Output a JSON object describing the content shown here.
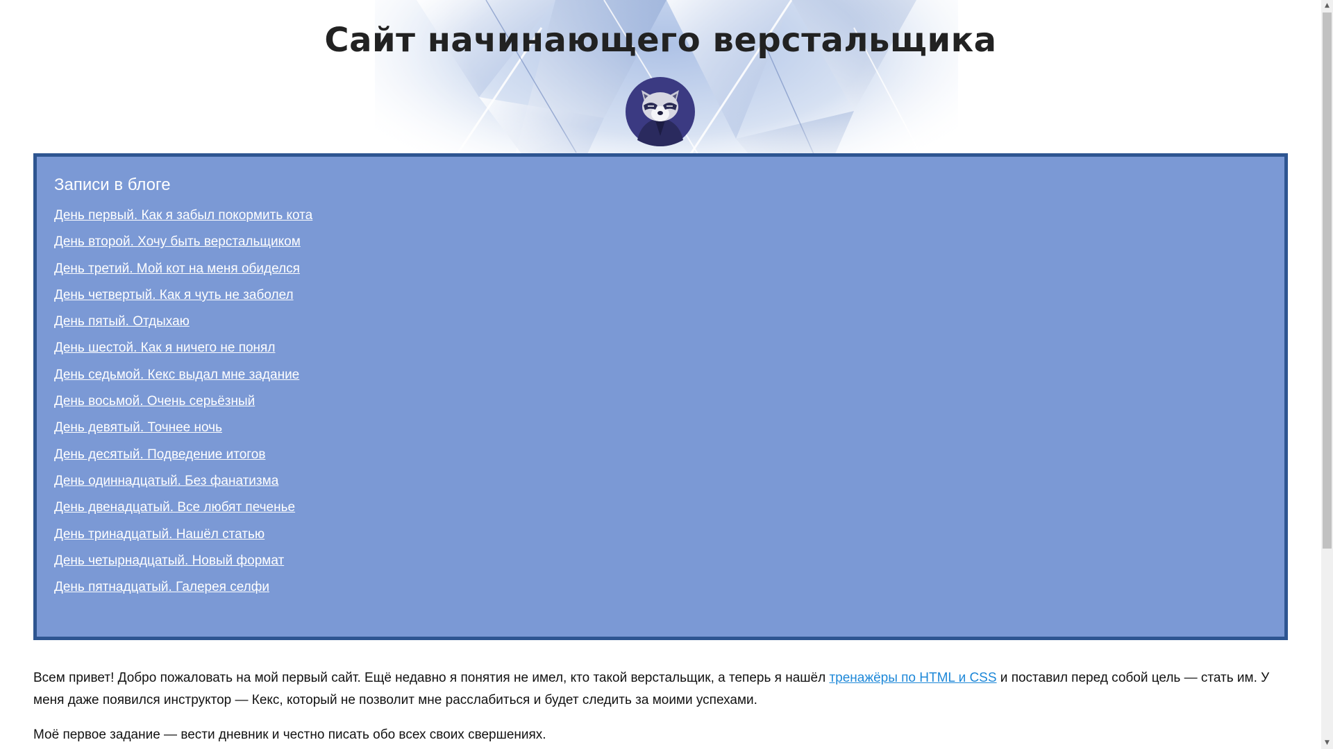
{
  "header": {
    "title": "Сайт начинающего верстальщика",
    "avatar_icon": "raccoon-avatar-icon"
  },
  "blog": {
    "heading": "Записи в блоге",
    "posts": [
      "День первый. Как я забыл покормить кота",
      "День второй. Хочу быть верстальщиком",
      "День третий. Мой кот на меня обиделся",
      "День четвертый. Как я чуть не заболел",
      "День пятый. Отдыхаю",
      "День шестой. Как я ничего не понял",
      "День седьмой. Кекс выдал мне задание",
      "День восьмой. Очень серьёзный",
      "День девятый. Точнее ночь",
      "День десятый. Подведение итогов",
      "День одиннадцатый. Без фанатизма",
      "День двенадцатый. Все любят печенье",
      "День тринадцатый. Нашёл статью",
      "День четырнадцатый. Новый формат",
      "День пятнадцатый. Галерея селфи"
    ]
  },
  "intro": {
    "text_before": "Всем привет! Добро пожаловать на мой первый сайт. Ещё недавно я понятия не имел, кто такой верстальщик, а теперь я нашёл ",
    "link_text": "тренажёры по HTML и CSS",
    "text_after": " и поставил перед собой цель — стать им. У меня даже появился инструктор — Кекс, который не позволит мне расслабиться и будет следить за моими успехами."
  },
  "task": {
    "text": "Моё первое задание — вести дневник и честно писать обо всех своих свершениях."
  },
  "scrollbar": {
    "up_icon": "scroll-up-arrow-icon",
    "down_icon": "scroll-down-arrow-icon"
  },
  "colors": {
    "panel_bg": "#7b99d5",
    "panel_border": "#2e5591",
    "link_white": "#ffffff",
    "intro_link": "#1e88d8",
    "title": "#222222"
  }
}
